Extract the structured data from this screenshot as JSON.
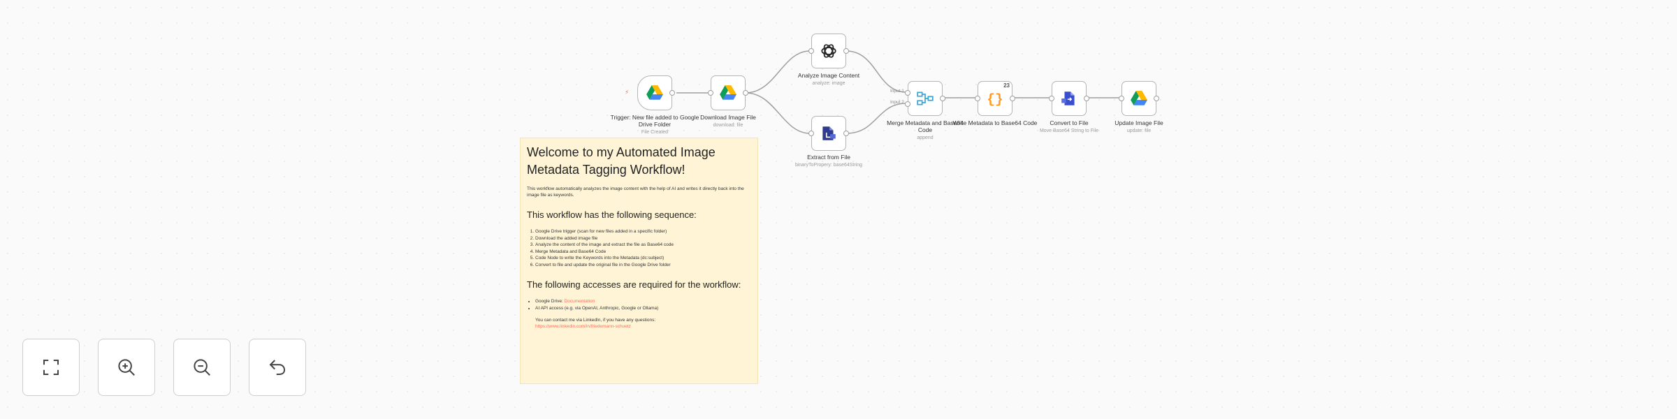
{
  "nodes": {
    "trigger": {
      "label": "Trigger: New file added to Google Drive Folder",
      "sub": "File Created"
    },
    "download": {
      "label": "Download Image File",
      "sub": "download: file"
    },
    "analyze": {
      "label": "Analyze Image Content",
      "sub": "analyze: image"
    },
    "extract": {
      "label": "Extract from File",
      "sub": "binaryToPropery: base64String"
    },
    "merge": {
      "label": "Merge Metadata and Base64 Code",
      "sub": "append",
      "port_top": "Input 1",
      "port_bot": "Input 2"
    },
    "write": {
      "label": "Write Metadata to Base64 Code",
      "badge": "23"
    },
    "convert": {
      "label": "Convert to File",
      "sub": "Move Base64 String to File"
    },
    "update": {
      "label": "Update Image File",
      "sub": "update: file"
    }
  },
  "note": {
    "title": "Welcome to my Automated Image Metadata Tagging Workflow!",
    "intro": "This workflow automatically analyzes the image content with the help of AI and writes it directly back into the image file as keywords.",
    "sequence_heading": "This workflow has the following sequence:",
    "steps": [
      "Google Drive trigger (scan for new files added in a specific folder)",
      "Download the added image file",
      "Analyze the content of the image and extract the file as Base64 code",
      "Merge Metadata and Base64 Code",
      "Code Node to write the Keywords into the Metadata (dc:subject)",
      "Convert to file and update the original file in the Google Drive folder"
    ],
    "access_heading": "The following accesses are required for the workflow:",
    "access": [
      {
        "text": "Google Drive: ",
        "link": "Documentation"
      },
      {
        "text": "AI API access (e.g. via OpenAI, Anthropic, Google or Ollama)",
        "link": ""
      }
    ],
    "contact_text": "You can contact me via LinkedIn, if you have any questions:",
    "contact_link": "https://www.linkedin.com/in/friedemann-schuetz"
  },
  "colors": {
    "accent": "#ff6d5a",
    "note_bg": "#fff5d6",
    "edge": "#9e9e9e",
    "node_border": "#b5b5b5"
  },
  "icons": {
    "trigger": "google-drive-icon",
    "download": "google-drive-icon",
    "analyze": "openai-icon",
    "extract": "file-extract-icon",
    "merge": "merge-icon",
    "write": "code-braces-icon",
    "convert": "convert-file-icon",
    "update": "google-drive-icon",
    "controls": [
      "fit-view-icon",
      "zoom-in-icon",
      "zoom-out-icon",
      "undo-icon"
    ]
  }
}
